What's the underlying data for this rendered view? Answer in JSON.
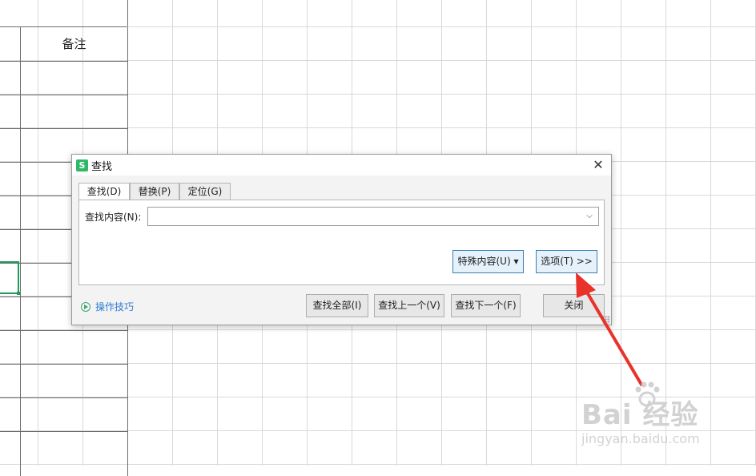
{
  "sheet": {
    "remark_header": "备注"
  },
  "dialog": {
    "title": "查找",
    "close_glyph": "✕",
    "tabs": [
      {
        "label": "查找(D)",
        "active": true
      },
      {
        "label": "替换(P)",
        "active": false
      },
      {
        "label": "定位(G)",
        "active": false
      }
    ],
    "find_label": "查找内容(N):",
    "find_value": "",
    "special_button": "特殊内容(U) ▾",
    "options_button": "选项(T) >>",
    "tips_link": "操作技巧",
    "find_all_button": "查找全部(I)",
    "find_prev_button": "查找上一个(V)",
    "find_next_button": "查找下一个(F)",
    "close_button": "关闭"
  },
  "watermark": {
    "brand": "Bai  经验",
    "url": "jingyan.baidu.com"
  },
  "colors": {
    "accent_green": "#1e9b5d",
    "arrow_red": "#e8322a",
    "link_blue": "#2f7dd1"
  }
}
